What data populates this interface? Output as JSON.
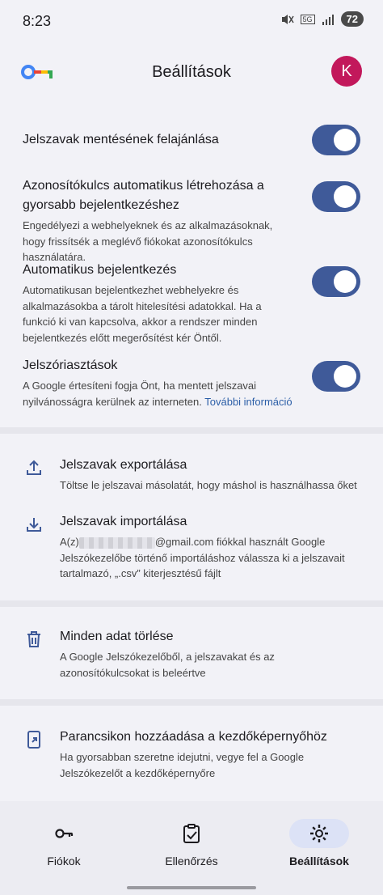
{
  "status": {
    "time": "8:23",
    "network": "5G",
    "battery": "72"
  },
  "header": {
    "title": "Beállítások",
    "avatar_letter": "K"
  },
  "toggles": [
    {
      "title": "Jelszavak mentésének felajánlása",
      "desc": "",
      "on": true
    },
    {
      "title": "Azonosítókulcs automatikus létrehozása a gyorsabb bejelentkezéshez",
      "desc": "Engedélyezi a webhelyeknek és az alkalmazásoknak, hogy frissítsék a meglévő fiókokat azonosítókulcs használatára.",
      "on": true
    },
    {
      "title": "Automatikus bejelentkezés",
      "desc": "Automatikusan bejelentkezhet webhelyekre és alkalmazásokba a tárolt hitelesítési adatokkal. Ha a funkció ki van kapcsolva, akkor a rendszer minden bejelentkezés előtt megerősítést kér Öntől.",
      "on": true
    },
    {
      "title": "Jelszóriasztások",
      "desc": "A Google értesíteni fogja Önt, ha mentett jelszavai nyilvánosságra kerülnek az interneten.",
      "link": "További információ",
      "on": true
    }
  ],
  "actions": {
    "export": {
      "title": "Jelszavak exportálása",
      "desc": "Töltse le jelszavai másolatát, hogy máshol is használhassa őket"
    },
    "import": {
      "title": "Jelszavak importálása",
      "desc_prefix": "A(z)",
      "desc_suffix": "@gmail.com fiókkal használt Google Jelszókezelőbe történő importáláshoz válassza ki a jelszavait tartalmazó, „.csv” kiterjesztésű fájlt"
    },
    "delete": {
      "title": "Minden adat törlése",
      "desc": "A Google Jelszókezelőből, a jelszavakat és az azonosítókulcsokat is beleértve"
    },
    "shortcut": {
      "title": "Parancsikon hozzáadása a kezdőképernyőhöz",
      "desc": "Ha gyorsabban szeretne idejutni, vegye fel a Google Jelszókezelőt a kezdőképernyőre"
    }
  },
  "nav": [
    {
      "label": "Fiókok",
      "icon": "key-icon",
      "active": false
    },
    {
      "label": "Ellenőrzés",
      "icon": "checkup-icon",
      "active": false
    },
    {
      "label": "Beállítások",
      "icon": "gear-icon",
      "active": true
    }
  ]
}
